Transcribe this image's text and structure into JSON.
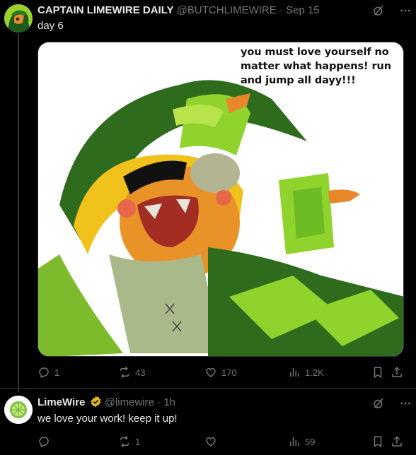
{
  "tweet1": {
    "display_name": "CAPTAIN LIMEWIRE DAILY",
    "handle": "@BUTCHLIMEWIRE",
    "separator": "·",
    "date": "Sep 15",
    "text": "day 6",
    "image_caption": "you must love yourself no matter what happens! run and jump all dayy!!!",
    "replies": "1",
    "reposts": "43",
    "likes": "170",
    "views": "1.2K"
  },
  "tweet2": {
    "display_name": "LimeWire",
    "handle": "@limewire",
    "separator": "·",
    "time": "1h",
    "text": "we love your work! keep it up!",
    "replies": "",
    "reposts": "1",
    "likes": "",
    "views": "59"
  },
  "colors": {
    "background": "#000000",
    "text": "#e7e9ea",
    "muted": "#71767b",
    "verified_gold": "#e2b719",
    "limewire_green": "#7ac143"
  },
  "icons": [
    "grok-icon",
    "more-icon",
    "reply-icon",
    "repost-icon",
    "like-icon",
    "views-icon",
    "bookmark-icon",
    "share-icon",
    "verified-badge-icon"
  ]
}
